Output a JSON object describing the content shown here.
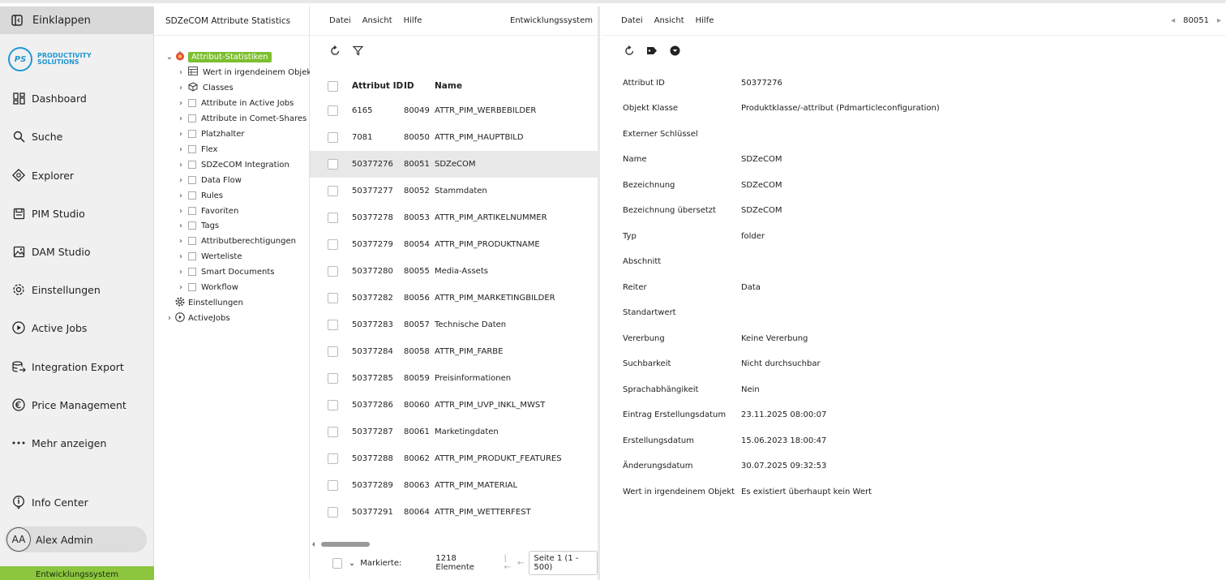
{
  "sidebar": {
    "collapse_label": "Einklappen",
    "logo": {
      "mark": "PS",
      "line1": "PRODUCTIVITY",
      "line2": "SOLUTIONS"
    },
    "items": [
      {
        "label": "Dashboard",
        "icon": "dashboard-icon"
      },
      {
        "label": "Suche",
        "icon": "search-icon"
      },
      {
        "label": "Explorer",
        "icon": "explorer-icon"
      },
      {
        "label": "PIM Studio",
        "icon": "pim-studio-icon"
      },
      {
        "label": "DAM Studio",
        "icon": "image-icon"
      },
      {
        "label": "Einstellungen",
        "icon": "gear-icon"
      },
      {
        "label": "Active Jobs",
        "icon": "play-icon"
      },
      {
        "label": "Integration Export",
        "icon": "database-export-icon"
      },
      {
        "label": "Price Management",
        "icon": "euro-icon"
      },
      {
        "label": "Mehr anzeigen",
        "icon": "more-icon"
      }
    ],
    "info_center": "Info Center",
    "user": {
      "initials": "AA",
      "name": "Alex Admin"
    },
    "environment": "Entwicklungssystem"
  },
  "tree": {
    "title": "SDZeCOM Attribute Statistics",
    "root": "Attribut-Statistiken",
    "children": [
      "Wert in irgendeinem Objekt",
      "Classes",
      "Attribute in Active Jobs",
      "Attribute in Comet-Shares",
      "Platzhalter",
      "Flex",
      "SDZeCOM Integration",
      "Data Flow",
      "Rules",
      "Favoriten",
      "Tags",
      "Attributberechtigungen",
      "Werteliste",
      "Smart Documents",
      "Workflow"
    ],
    "settings": "Einstellungen",
    "active_jobs": "ActiveJobs"
  },
  "list": {
    "menu": [
      "Datei",
      "Ansicht",
      "Hilfe"
    ],
    "environment": "Entwicklungssystem",
    "columns": [
      "Attribut ID",
      "ID",
      "Name"
    ],
    "rows": [
      [
        "6165",
        "80049",
        "ATTR_PIM_WERBEBILDER"
      ],
      [
        "7081",
        "80050",
        "ATTR_PIM_HAUPTBILD"
      ],
      [
        "50377276",
        "80051",
        "SDZeCOM"
      ],
      [
        "50377277",
        "80052",
        "Stammdaten"
      ],
      [
        "50377278",
        "80053",
        "ATTR_PIM_ARTIKELNUMMER"
      ],
      [
        "50377279",
        "80054",
        "ATTR_PIM_PRODUKTNAME"
      ],
      [
        "50377280",
        "80055",
        "Media-Assets"
      ],
      [
        "50377282",
        "80056",
        "ATTR_PIM_MARKETINGBILDER"
      ],
      [
        "50377283",
        "80057",
        "Technische Daten"
      ],
      [
        "50377284",
        "80058",
        "ATTR_PIM_FARBE"
      ],
      [
        "50377285",
        "80059",
        "Preisinformationen"
      ],
      [
        "50377286",
        "80060",
        "ATTR_PIM_UVP_INKL_MWST"
      ],
      [
        "50377287",
        "80061",
        "Marketingdaten"
      ],
      [
        "50377288",
        "80062",
        "ATTR_PIM_PRODUKT_FEATURES"
      ],
      [
        "50377289",
        "80063",
        "ATTR_PIM_MATERIAL"
      ],
      [
        "50377291",
        "80064",
        "ATTR_PIM_WETTERFEST"
      ]
    ],
    "selected_row": 2,
    "footer": {
      "marked_label": "Markierte:",
      "count": "1218 Elemente",
      "page": "Seite 1 (1 - 500)"
    }
  },
  "detail": {
    "menu": [
      "Datei",
      "Ansicht",
      "Hilfe"
    ],
    "record_id": "80051",
    "fields": [
      {
        "label": "Attribut ID",
        "value": "50377276"
      },
      {
        "label": "Objekt Klasse",
        "value": "Produktklasse/-attribut (Pdmarticleconfiguration)"
      },
      {
        "label": "Externer Schlüssel",
        "value": ""
      },
      {
        "label": "Name",
        "value": "SDZeCOM"
      },
      {
        "label": "Bezeichnung",
        "value": "SDZeCOM"
      },
      {
        "label": "Bezeichnung übersetzt",
        "value": "SDZeCOM"
      },
      {
        "label": "Typ",
        "value": "folder"
      },
      {
        "label": "Abschnitt",
        "value": ""
      },
      {
        "label": "Reiter",
        "value": "Data"
      },
      {
        "label": "Standartwert",
        "value": ""
      },
      {
        "label": "Vererbung",
        "value": "Keine Vererbung"
      },
      {
        "label": "Suchbarkeit",
        "value": "Nicht durchsuchbar"
      },
      {
        "label": "Sprachabhängikeit",
        "value": "Nein"
      },
      {
        "label": "Eintrag Erstellungsdatum",
        "value": "23.11.2025 08:00:07"
      },
      {
        "label": "Erstellungsdatum",
        "value": "15.06.2023 18:00:47"
      },
      {
        "label": "Änderungsdatum",
        "value": "30.07.2025 09:32:53"
      },
      {
        "label": "Wert in irgendeinem Objekt",
        "value": "Es existiert überhaupt kein Wert"
      }
    ]
  },
  "colors": {
    "accent_green": "#8cc63f",
    "brand_blue": "#1f97d4",
    "selected_row": "#e8e8e8"
  }
}
